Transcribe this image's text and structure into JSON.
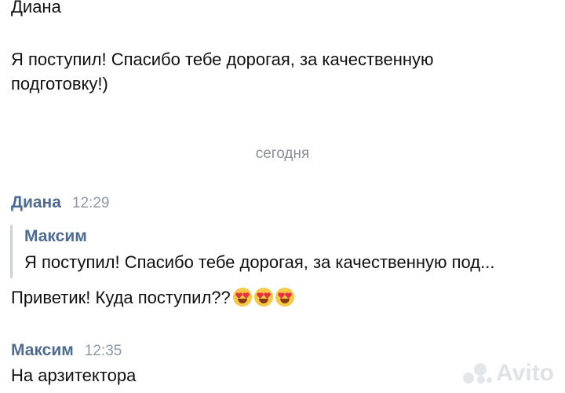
{
  "top_partial_text": "Диана",
  "top_message": {
    "lines": [
      "Я поступил! Спасибо тебе дорогая, за качественную",
      "подготовку!)"
    ]
  },
  "date_separator": "сегодня",
  "messages": [
    {
      "sender": "Диана",
      "time": "12:29",
      "reply": {
        "author": "Максим",
        "text": "Я поступил! Спасибо тебе дорогая, за качественную под..."
      },
      "text": "Приветик! Куда поступил??",
      "emojis": [
        "heart-eyes-emoji",
        "heart-eyes-emoji",
        "heart-eyes-emoji"
      ]
    },
    {
      "sender": "Максим",
      "time": "12:35",
      "text": "На арзитектора"
    }
  ],
  "watermark": "Avito",
  "colors": {
    "sender_name": "#4e6b91",
    "timestamp": "#8e9aa8",
    "quote_bar": "#c5d0dd"
  }
}
